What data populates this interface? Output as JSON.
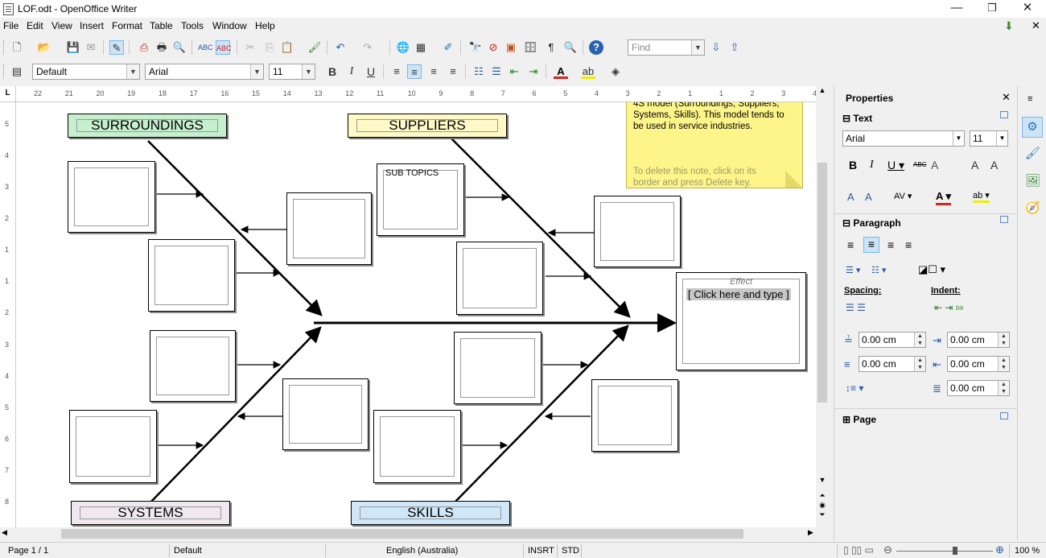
{
  "window": {
    "title": "LOF.odt - OpenOffice Writer",
    "controls": {
      "minimize": "—",
      "maximize": "❐",
      "close": "✕"
    }
  },
  "menu": [
    "File",
    "Edit",
    "View",
    "Insert",
    "Format",
    "Table",
    "Tools",
    "Window",
    "Help"
  ],
  "menu_underline": [
    "F",
    "E",
    "V",
    "I",
    "o",
    "a",
    "T",
    "W",
    "H"
  ],
  "toolbar": {
    "find_placeholder": "Find",
    "paragraph_style": "Default",
    "font_name": "Arial",
    "font_size": "11"
  },
  "ruler": {
    "labels": [
      "22",
      "21",
      "20",
      "19",
      "18",
      "17",
      "16",
      "15",
      "14",
      "13",
      "12",
      "11",
      "10",
      "9",
      "8",
      "7",
      "6",
      "5",
      "4",
      "3",
      "2",
      "1",
      "1",
      "2",
      "3",
      "4"
    ],
    "vertical_labels": [
      "5",
      "4",
      "3",
      "2",
      "1",
      "1",
      "2",
      "3",
      "4",
      "5",
      "6",
      "7",
      "8"
    ]
  },
  "diagram": {
    "categories": {
      "surroundings": "SURROUNDINGS",
      "suppliers": "SUPPLIERS",
      "systems": "SYSTEMS",
      "skills": "SKILLS"
    },
    "subtopics_label": "SUB TOPICS",
    "effect_label": "Effect",
    "effect_placeholder": "[ Click here and type ]",
    "note": {
      "text": "4S model (Surroundings, Suppliers, Systems, Skills). This model tends to be used in service industries.",
      "hint": "To delete this note, click on its border and press Delete key."
    },
    "colors": {
      "surroundings": "#c6efce",
      "suppliers": "#fef9c6",
      "systems": "#efe9ef",
      "skills": "#cfe7f6",
      "note": "#fdf58a"
    }
  },
  "sidebar": {
    "title": "Properties",
    "sections": {
      "text": "Text",
      "paragraph": "Paragraph",
      "page": "Page"
    },
    "font_name": "Arial",
    "font_size": "11",
    "spacing_label": "Spacing:",
    "indent_label": "Indent:",
    "fields": {
      "above": "0.00 cm",
      "below": "0.00 cm",
      "before": "0.00 cm",
      "after": "0.00 cm",
      "first_line": "0.00 cm"
    }
  },
  "statusbar": {
    "page": "Page 1 / 1",
    "style": "Default",
    "language": "English (Australia)",
    "insert_mode": "INSRT",
    "selection_mode": "STD",
    "zoom": "100 %"
  }
}
